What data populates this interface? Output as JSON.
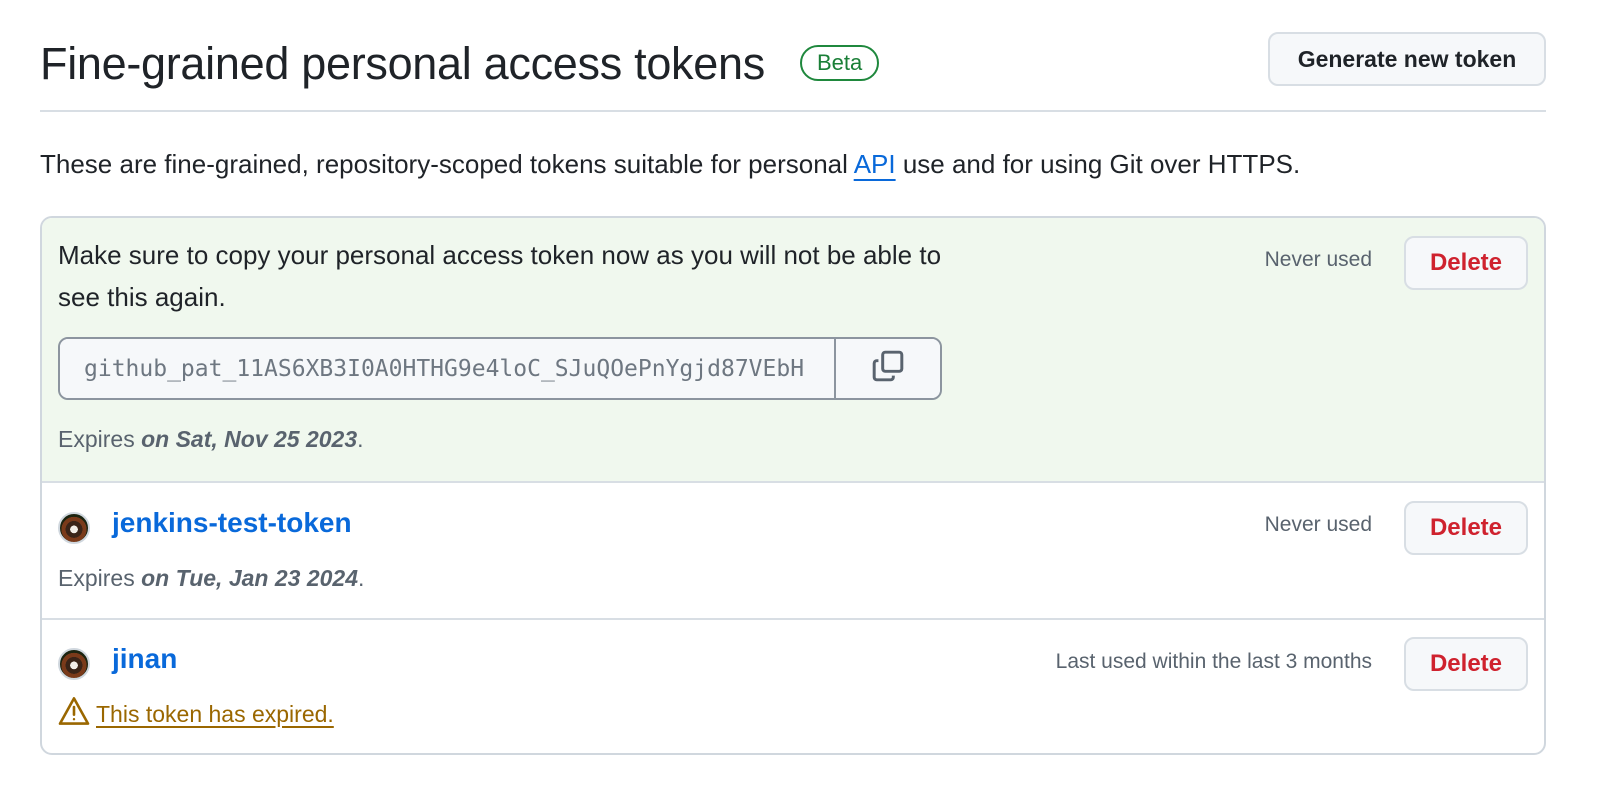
{
  "header": {
    "title": "Fine-grained personal access tokens",
    "badge": "Beta",
    "generate_button": "Generate new token"
  },
  "description": {
    "before": "These are fine-grained, repository-scoped tokens suitable for personal ",
    "link": "API",
    "after": " use and for using Git over HTTPS."
  },
  "new_token": {
    "message": "Make sure to copy your personal access token now as you will not be able to see this again.",
    "value": "github_pat_11AS6XB3I0A0HTHG9e4loC_SJuQOePnYgjd87VEbH",
    "copy_icon": "copy-icon",
    "expires_prefix": "Expires ",
    "expires_date": "on Sat, Nov 25 2023",
    "expires_suffix": ".",
    "usage": "Never used",
    "delete_label": "Delete"
  },
  "tokens": [
    {
      "name": "jenkins-test-token",
      "usage": "Never used",
      "expires_prefix": "Expires ",
      "expires_date": "on Tue, Jan 23 2024",
      "expires_suffix": ".",
      "delete_label": "Delete"
    },
    {
      "name": "jinan",
      "usage": "Last used within the last 3 months",
      "expired_message": "This token has expired.",
      "warning_icon": "alert-icon",
      "delete_label": "Delete"
    }
  ],
  "colors": {
    "link": "#0969da",
    "danger": "#cf222e",
    "success": "#1a7f37",
    "warning": "#9a6700",
    "new_token_bg": "#f0f8ee"
  }
}
